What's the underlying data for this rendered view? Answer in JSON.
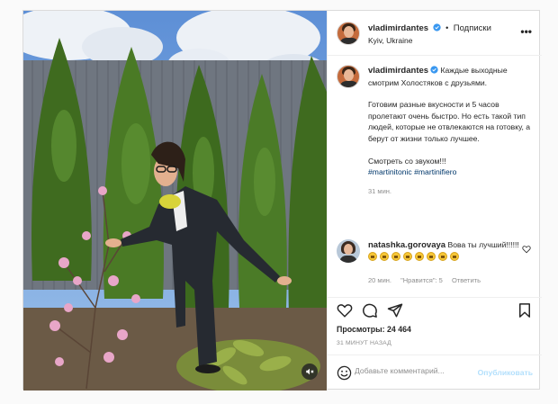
{
  "post": {
    "username": "vladimirdantes",
    "follow_label": "Подписки",
    "location": "Kyiv, Ukraine",
    "more_label": "•••"
  },
  "caption": {
    "username": "vladimirdantes",
    "text_1": "Каждые выходные смотрим Холостяков с друзьями.",
    "text_2": "Готовим разные вкусности и 5 часов пролетают очень быстро. Но есть такой тип людей, которые не отвлекаются на готовку, а берут от жизни только лучшее.",
    "text_3": "Смотреть со звуком!!!",
    "hashtag_1": "#martinitonic",
    "hashtag_2": "#martinifiero",
    "time": "31 мин."
  },
  "comment": {
    "username": "natashka.gorovaya",
    "text": "Вова ты лучший!!!!!!",
    "emoji_count": 8,
    "time": "20 мин.",
    "likes": "\"Нравится\": 5",
    "reply": "Ответить"
  },
  "actions": {
    "views": "Просмотры: 24 464",
    "time_ago": "31 МИНУТ НАЗАД"
  },
  "add_comment": {
    "placeholder": "Добавьте комментарий...",
    "publish": "Опубликовать"
  },
  "icons": {
    "verified": "verified-badge-icon",
    "heart": "heart-icon",
    "comment": "comment-icon",
    "share": "share-icon",
    "save": "bookmark-icon",
    "emoji": "smiley-icon",
    "mute": "speaker-muted-icon",
    "more": "more-dots-icon"
  },
  "colors": {
    "link": "#00376b",
    "verified": "#3897f0",
    "publish_disabled": "#b2dffc",
    "muted_text": "#8e8e8e"
  }
}
